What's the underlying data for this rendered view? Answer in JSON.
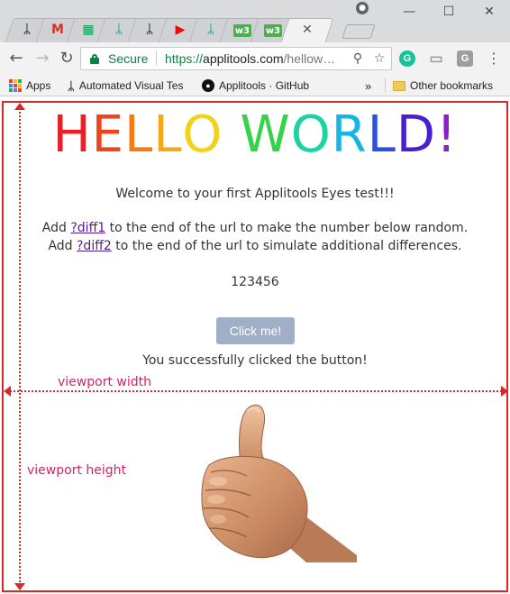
{
  "window": {
    "minimize_glyph": "—",
    "maximize_glyph": "☐",
    "close_glyph": "✕",
    "profile_icon": "person-icon"
  },
  "tabs": [
    {
      "icon": "applitools-icon",
      "glyph": "ᛦ",
      "color": "#444444"
    },
    {
      "icon": "gmail-icon",
      "glyph": "M",
      "color": "#d93025"
    },
    {
      "icon": "sheets-icon",
      "glyph": "▦",
      "color": "#0f9d58"
    },
    {
      "icon": "applitools-teal-icon",
      "glyph": "ᛦ",
      "color": "#2bb5b5"
    },
    {
      "icon": "applitools-icon",
      "glyph": "ᛦ",
      "color": "#444444"
    },
    {
      "icon": "youtube-icon",
      "glyph": "▶",
      "color": "#ff0000"
    },
    {
      "icon": "applitools-teal-icon",
      "glyph": "ᛦ",
      "color": "#2bb5b5"
    },
    {
      "icon": "w3-icon",
      "glyph": "w3",
      "color": "#4caf50"
    },
    {
      "icon": "w3-icon",
      "glyph": "w3",
      "color": "#4caf50"
    },
    {
      "icon": "close-tab-icon",
      "glyph": "✕",
      "color": "#555555",
      "active": true
    }
  ],
  "toolbar": {
    "back_glyph": "←",
    "forward_glyph": "→",
    "reload_glyph": "↻",
    "secure_label": "Secure",
    "url_scheme": "https://",
    "url_host": "applitools.com",
    "url_rest": "/hellow…",
    "zoom_glyph": "⚲",
    "star_glyph": "☆",
    "grammarly_letter": "G",
    "cast_glyph": "▭",
    "ext_letter": "G",
    "menu_glyph": "⋮"
  },
  "bookmarks": {
    "apps": "Apps",
    "items": [
      {
        "label": "Automated Visual Tes",
        "icon": "applitools-icon"
      },
      {
        "label": "Applitools · GitHub",
        "icon": "github-icon"
      }
    ],
    "overflow": "»",
    "other": "Other bookmarks"
  },
  "page": {
    "hello_letters": [
      {
        "ch": "H",
        "color": "#e8202a"
      },
      {
        "ch": "E",
        "color": "#f0451c"
      },
      {
        "ch": "L",
        "color": "#f57c10"
      },
      {
        "ch": "L",
        "color": "#f7a81a"
      },
      {
        "ch": "O",
        "color": "#f3d21c"
      },
      {
        "ch": " ",
        "color": "#ffffff"
      },
      {
        "ch": "W",
        "color": "#36d24a"
      },
      {
        "ch": "O",
        "color": "#1bd4a0"
      },
      {
        "ch": "R",
        "color": "#19b4e6"
      },
      {
        "ch": "L",
        "color": "#2e4fe6"
      },
      {
        "ch": "D",
        "color": "#4a1fd0"
      },
      {
        "ch": "!",
        "color": "#8a1ecf"
      }
    ],
    "welcome": "Welcome to your first Applitools Eyes test!!!",
    "line1_prefix": "Add ",
    "line1_link": "?diff1",
    "line1_suffix": " to the end of the url to make the number below random.",
    "line2_prefix": "Add ",
    "line2_link": "?diff2",
    "line2_suffix": " to the end of the url to simulate additional differences.",
    "number": "123456",
    "button": "Click me!",
    "success": "You successfully clicked the button!"
  },
  "annotations": {
    "width_label": "viewport width",
    "height_label": "viewport height"
  },
  "colors": {
    "annotation": "#d62828",
    "annotation_text": "#d6246b",
    "button": "#9fb0c6",
    "link": "#551a8b"
  }
}
